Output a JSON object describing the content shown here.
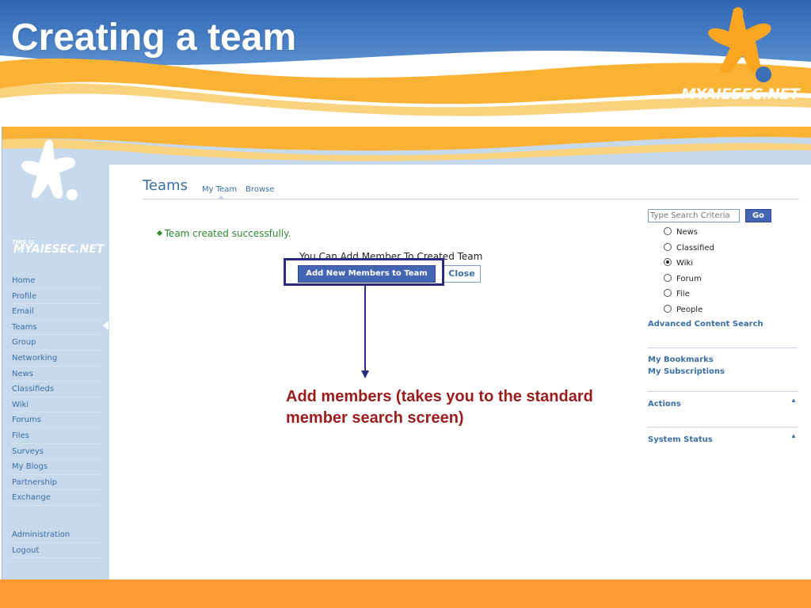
{
  "slide": {
    "title": "Creating a team",
    "header_logo": "MYAIESEC.NET",
    "colors": {
      "banner_blue": "#3b72b9",
      "banner_orange": "#f9b233",
      "footer_orange": "#ff9a33",
      "annotation_red": "#9b1c1c",
      "highlight_navy": "#2a2a80"
    }
  },
  "app": {
    "sidebar": {
      "logo_small": "THIS IS",
      "logo": "MYAIESEC.NET",
      "nav_items": [
        "Home",
        "Profile",
        "Email",
        "Teams",
        "Group",
        "Networking",
        "News",
        "Classifieds",
        "Wiki",
        "Forums",
        "Files",
        "Surveys",
        "My Blogs",
        "Partnership",
        "Exchange"
      ],
      "admin_items": [
        "Administration",
        "Logout"
      ],
      "active_item": "Teams"
    },
    "main": {
      "page_title": "Teams",
      "tabs": [
        {
          "label": "My Team",
          "active": true
        },
        {
          "label": "Browse",
          "active": false
        }
      ],
      "success_message": "Team created successfully.",
      "add_prompt": "You Can Add Member To Created Team",
      "add_button_label": "Add New Members to Team",
      "close_button_label": "Close"
    },
    "right_panel": {
      "search_placeholder": "Type Search Criteria",
      "go_label": "Go",
      "search_options": [
        {
          "label": "News",
          "checked": false
        },
        {
          "label": "Classified",
          "checked": false
        },
        {
          "label": "Wiki",
          "checked": true
        },
        {
          "label": "Forum",
          "checked": false
        },
        {
          "label": "File",
          "checked": false
        },
        {
          "label": "People",
          "checked": false
        }
      ],
      "advanced_search": "Advanced Content Search",
      "bookmarks": "My Bookmarks",
      "subscriptions": "My Subscriptions",
      "actions": "Actions",
      "system_status": "System Status"
    }
  },
  "annotation": {
    "text": "Add members (takes you to the standard member search screen)"
  }
}
